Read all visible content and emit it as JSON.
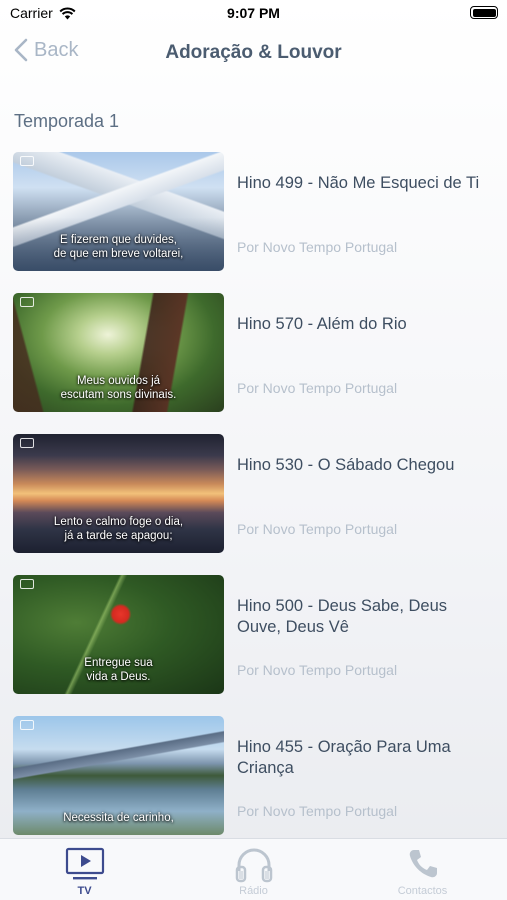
{
  "status_bar": {
    "carrier": "Carrier",
    "time": "9:07 PM",
    "battery_level": 1.0
  },
  "nav": {
    "back_label": "Back",
    "title": "Adoração & Louvor"
  },
  "section": {
    "title": "Temporada 1"
  },
  "items": [
    {
      "title": "Hino 499 - Não Me Esqueci de Ti",
      "author": "Por Novo Tempo Portugal",
      "caption": "E fizerem que duvides,\nde que em breve voltarei,",
      "thumb_scene": "snowy-mountains"
    },
    {
      "title": "Hino 570 - Além do Rio",
      "author": "Por Novo Tempo Portugal",
      "caption": "Meus ouvidos já\nescutam sons divinais.",
      "thumb_scene": "forest-canopy"
    },
    {
      "title": "Hino 530 - O Sábado Chegou",
      "author": "Por Novo Tempo Portugal",
      "caption": "Lento e calmo foge o dia,\njá a tarde se apagou;",
      "thumb_scene": "sunset-sky"
    },
    {
      "title": "Hino 500 - Deus Sabe, Deus Ouve, Deus Vê",
      "author": "Por Novo Tempo Portugal",
      "caption": "Entregue sua\nvida a Deus.",
      "thumb_scene": "red-flower"
    },
    {
      "title": "Hino 455 - Oração Para Uma Criança",
      "author": "Por Novo Tempo Portugal",
      "caption": "Necessita de carinho,",
      "thumb_scene": "mountain-lake"
    }
  ],
  "tabs": [
    {
      "label": "TV",
      "icon": "tv-icon",
      "active": true
    },
    {
      "label": "Rádio",
      "icon": "headphones-icon",
      "active": false
    },
    {
      "label": "Contactos",
      "icon": "phone-icon",
      "active": false
    }
  ],
  "colors": {
    "accent": "#3d4b8e",
    "muted": "#b6c0cc",
    "title": "#4b5c70"
  }
}
